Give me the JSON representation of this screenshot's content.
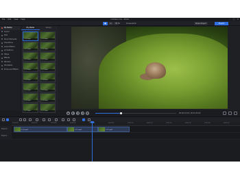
{
  "window": {
    "title": "Untitled.cmo - Editor",
    "menu": [
      "File",
      "Edit",
      "View",
      "Help"
    ],
    "controls": [
      "–",
      "□",
      "✕"
    ]
  },
  "toolbar": {
    "fit_label": "Fit",
    "screenshot_label": "Screenshot",
    "share_label": "Share Project",
    "export_label": "Export"
  },
  "sidebar": {
    "items": [
      {
        "label": "My Media",
        "active": true
      },
      {
        "label": "Sound"
      },
      {
        "label": "Text"
      },
      {
        "label": "Stock Elements"
      },
      {
        "label": "Transitions"
      },
      {
        "label": "Audio Effects"
      },
      {
        "label": "Animations"
      },
      {
        "label": "Filters"
      },
      {
        "label": "Effects"
      },
      {
        "label": "Stickers"
      },
      {
        "label": "Templates"
      },
      {
        "label": "Enhanced Effects"
      }
    ]
  },
  "media": {
    "tabs": [
      "My Media",
      "Library"
    ],
    "thumbs": [
      "1-10.mp4",
      "1-10.mp4",
      "1-11.mp4",
      "1-11.mp4",
      "1-12.mp4",
      "1-12.mp4",
      "1-13.mp4",
      "1-13.mp4",
      "1-14.mp4",
      "1-14.mp4",
      "1-15.mp4",
      "1-15.mp4",
      "1-16.mp4",
      "1-16.mp4",
      "1-17.mp4",
      "1-17.mp4"
    ]
  },
  "transport": {
    "timecode": "00:00:12.06 / 00:01:40.00",
    "progress_fraction": 0.32
  },
  "ruler": {
    "ticks": [
      "00:00:00",
      "00:00:10",
      "00:00:20",
      "00:00:30",
      "00:00:40",
      "00:00:50",
      "00:01:00",
      "00:01:10",
      "00:01:20",
      "00:01:30",
      "00:01:40",
      "00:01:50",
      "00:02:00"
    ]
  },
  "tracks": [
    {
      "label": "Track 2",
      "clips": [
        "1-10.mp4",
        "1-11.mp4",
        "1-12.mp4"
      ]
    },
    {
      "label": "Track 1",
      "clips": []
    }
  ],
  "colors": {
    "accent": "#2f6fe0",
    "background": "#1b1c20"
  }
}
